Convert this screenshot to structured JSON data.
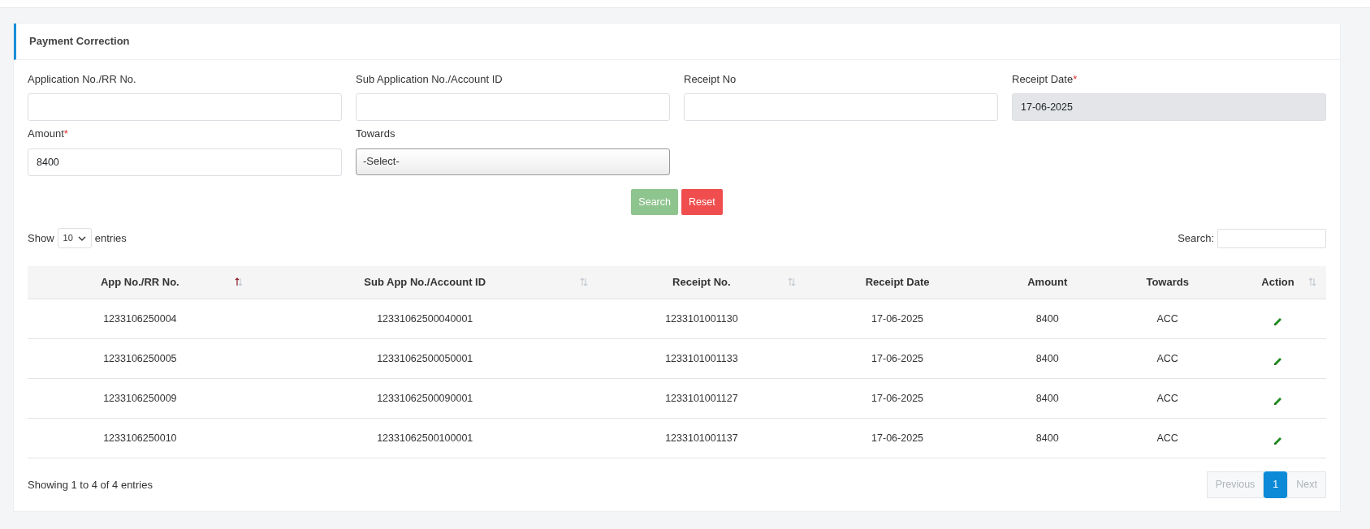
{
  "card": {
    "title": "Payment Correction"
  },
  "form_fields": [
    {
      "label": "Application No./RR No.",
      "kind": "text",
      "readonly": false
    },
    {
      "label": "Sub Application No./Account ID",
      "kind": "text",
      "readonly": false
    },
    {
      "label": "Receipt No",
      "kind": "text",
      "readonly": false
    },
    {
      "label": "Receipt Date",
      "required_mark": "*",
      "kind": "text",
      "value": "17-06-2025",
      "readonly": true
    },
    {
      "label": "Amount",
      "required_mark": "*",
      "kind": "text",
      "value": "8400",
      "readonly": false
    },
    {
      "label": "Towards",
      "kind": "select",
      "value": "-Select-"
    }
  ],
  "buttons": [
    {
      "label": "Search",
      "kind": "success"
    },
    {
      "label": "Reset",
      "kind": "danger"
    }
  ],
  "length": {
    "before": "Show",
    "value": "10",
    "after": "entries"
  },
  "filter": {
    "label": "Search:"
  },
  "table": {
    "columns": [
      {
        "label": "App No./RR No.",
        "kind": "sortable",
        "sorted": true
      },
      {
        "label": "Sub App No./Account ID",
        "kind": "sortable",
        "sorted": false
      },
      {
        "label": "Receipt No.",
        "kind": "sortable",
        "sorted": false
      },
      {
        "label": "Receipt Date",
        "kind": "plain"
      },
      {
        "label": "Amount",
        "kind": "plain"
      },
      {
        "label": "Towards",
        "kind": "plain"
      },
      {
        "label": "Action",
        "kind": "sortable",
        "sorted": false
      }
    ],
    "rows": [
      [
        "1233106250004",
        "12331062500040001",
        "1233101001130",
        "17-06-2025",
        "8400",
        "ACC"
      ],
      [
        "1233106250005",
        "12331062500050001",
        "1233101001133",
        "17-06-2025",
        "8400",
        "ACC"
      ],
      [
        "1233106250009",
        "12331062500090001",
        "1233101001127",
        "17-06-2025",
        "8400",
        "ACC"
      ],
      [
        "1233106250010",
        "12331062500100001",
        "1233101001137",
        "17-06-2025",
        "8400",
        "ACC"
      ]
    ]
  },
  "info": "Showing 1 to 4 of 4 entries",
  "pagination": [
    {
      "label": "Previous",
      "disabled": true,
      "selected": false
    },
    {
      "label": "1",
      "selected": true
    },
    {
      "label": "Next",
      "disabled": true,
      "selected": false
    }
  ]
}
